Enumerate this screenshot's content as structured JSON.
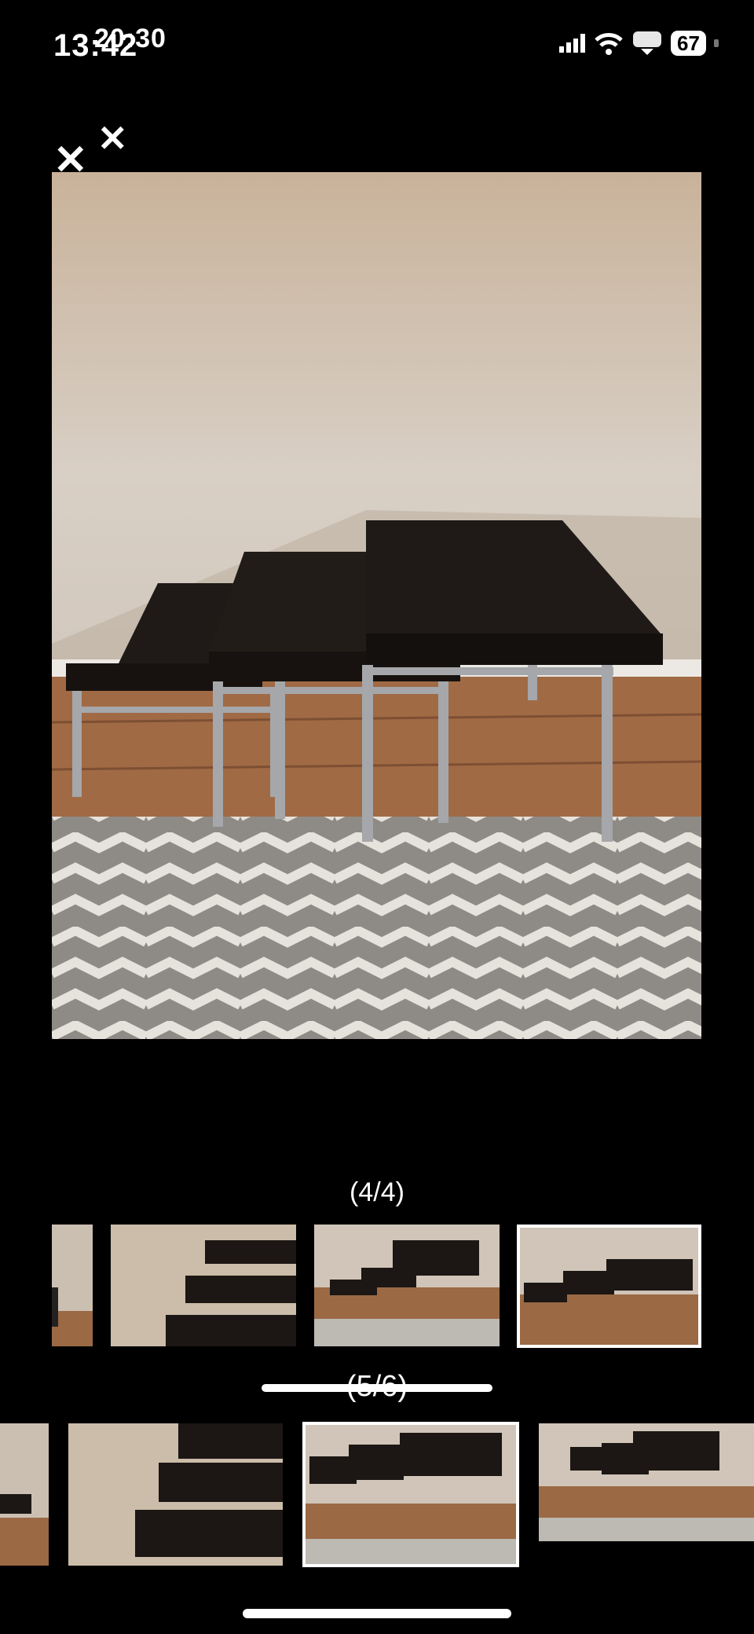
{
  "status_bar": {
    "time_front": "13:42",
    "time_back": "20:30",
    "battery": "67"
  },
  "photo_viewer_back": {
    "counter": "(4/4)"
  },
  "photo_viewer_front": {
    "counter": "(5/6)"
  },
  "colors": {
    "background": "#000000",
    "wall": "#d6c9bb",
    "table_top": "#1f1a17",
    "table_leg": "#a5a7aa",
    "floor": "#a06a45",
    "rug_light": "#e6e2dc",
    "rug_dark": "#8e8b86"
  }
}
